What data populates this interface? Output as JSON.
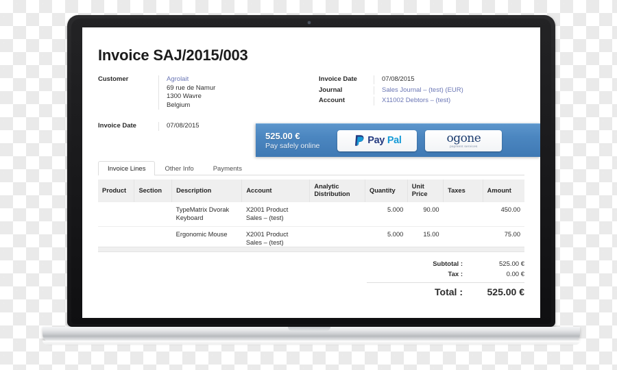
{
  "device": {
    "type": "laptop-mockup",
    "camera": "webcam-dot"
  },
  "invoice": {
    "title": "Invoice SAJ/2015/003",
    "left_fields": [
      {
        "label": "Customer",
        "lines": [
          "Agrolait",
          "69 rue de Namur",
          "1300 Wavre",
          "Belgium"
        ],
        "link_first_line": true
      },
      {
        "label": "Invoice Date",
        "lines": [
          "07/08/2015"
        ],
        "link_first_line": false
      }
    ],
    "right_fields": [
      {
        "label": "Invoice Date",
        "value": "07/08/2015",
        "is_link": false
      },
      {
        "label": "Journal",
        "value": "Sales Journal – (test) (EUR)",
        "is_link": true
      },
      {
        "label": "Account",
        "value": "X11002 Debtors – (test)",
        "is_link": true
      }
    ]
  },
  "payment_banner": {
    "amount": "525.00 €",
    "subtitle": "Pay safely online",
    "background_color": "#4b86c0",
    "buttons": [
      {
        "name": "paypal",
        "text_dark": "Pay",
        "text_light": "Pal",
        "mark": "P"
      },
      {
        "name": "ogone",
        "brand": "ogone",
        "tagline": "payment services"
      }
    ]
  },
  "tabs": [
    {
      "label": "Invoice Lines",
      "active": true
    },
    {
      "label": "Other Info",
      "active": false
    },
    {
      "label": "Payments",
      "active": false
    }
  ],
  "table": {
    "columns": [
      "Product",
      "Section",
      "Description",
      "Account",
      "Analytic Distribution",
      "Quantity",
      "Unit Price",
      "Taxes",
      "Amount"
    ],
    "rows": [
      {
        "product": "",
        "section": "",
        "description": "TypeMatrix Dvorak Keyboard",
        "account": "X2001 Product Sales – (test)",
        "analytic": "",
        "quantity": "5.000",
        "unit_price": "90.00",
        "taxes": "",
        "amount": "450.00"
      },
      {
        "product": "",
        "section": "",
        "description": "Ergonomic Mouse",
        "account": "X2001 Product Sales – (test)",
        "analytic": "",
        "quantity": "5.000",
        "unit_price": "15.00",
        "taxes": "",
        "amount": "75.00"
      }
    ]
  },
  "totals": {
    "subtotal_label": "Subtotal :",
    "subtotal_value": "525.00 €",
    "tax_label": "Tax :",
    "tax_value": "0.00 €",
    "total_label": "Total :",
    "total_value": "525.00 €"
  }
}
